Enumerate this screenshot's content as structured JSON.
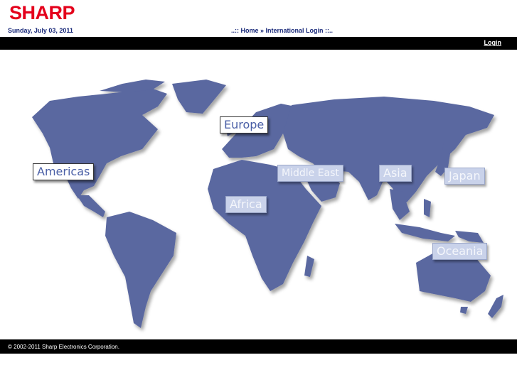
{
  "brand": {
    "logo_text": "SHARP",
    "color": "#e4001b"
  },
  "header": {
    "date": "Sunday, July 03, 2011",
    "breadcrumb_prefix": "..:: ",
    "breadcrumb_home": "Home",
    "breadcrumb_sep": " » ",
    "breadcrumb_current": "International Login",
    "breadcrumb_suffix": " ::.."
  },
  "topbar": {
    "login_label": "Login"
  },
  "map": {
    "land_color": "#5a67a0",
    "regions": [
      {
        "key": "americas",
        "label": "Americas",
        "style": "white"
      },
      {
        "key": "europe",
        "label": "Europe",
        "style": "white"
      },
      {
        "key": "middle-east",
        "label": "Middle East",
        "style": "light"
      },
      {
        "key": "asia",
        "label": "Asia",
        "style": "light"
      },
      {
        "key": "japan",
        "label": "Japan",
        "style": "light"
      },
      {
        "key": "africa",
        "label": "Africa",
        "style": "light"
      },
      {
        "key": "oceania",
        "label": "Oceania",
        "style": "light"
      }
    ]
  },
  "footer": {
    "copyright": "© 2002-2011 Sharp Electronics Corporation."
  }
}
